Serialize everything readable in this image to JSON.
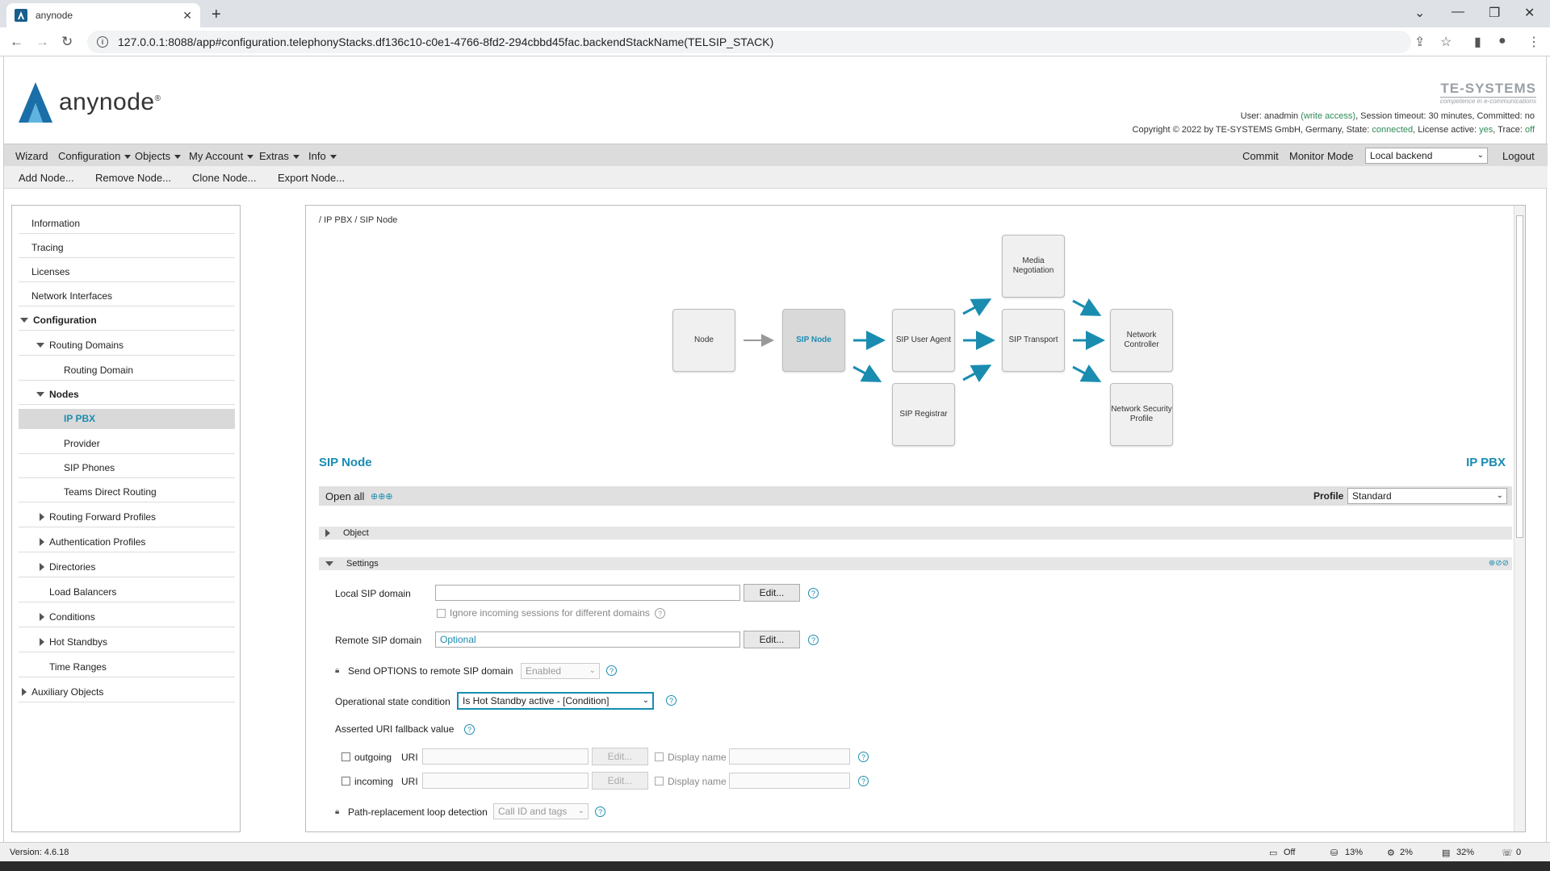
{
  "browser": {
    "tab_title": "anynode",
    "url": "127.0.0.1:8088/app#configuration.telephonyStacks.df136c10-c0e1-4766-8fd2-294cbbd45fac.backendStackName(TELSIP_STACK)"
  },
  "header": {
    "logo_text": "anynode",
    "logo_reg": "®",
    "brand_name": "TE-SYSTEMS",
    "brand_tagline": "competence in e-communications",
    "status_line1_prefix": "User: anadmin ",
    "status_write": "(write access)",
    "status_line1_suffix": ", Session timeout: 30 minutes, Committed: no",
    "status_line2_prefix": "Copyright © 2022 by TE-SYSTEMS GmbH, Germany, State: ",
    "status_state": "connected",
    "status_license_label": ", License active: ",
    "status_license": "yes",
    "status_trace_label": ", Trace: ",
    "status_trace": "off"
  },
  "menu": {
    "wizard": "Wizard",
    "configuration": "Configuration",
    "objects": "Objects",
    "my_account": "My Account",
    "extras": "Extras",
    "info": "Info",
    "commit": "Commit",
    "monitor_mode": "Monitor Mode",
    "backend_selected": "Local backend",
    "logout": "Logout"
  },
  "toolbar": {
    "add_node": "Add Node...",
    "remove_node": "Remove Node...",
    "clone_node": "Clone Node...",
    "export_node": "Export Node..."
  },
  "sidebar": {
    "items": [
      {
        "label": "Information"
      },
      {
        "label": "Tracing"
      },
      {
        "label": "Licenses"
      },
      {
        "label": "Network Interfaces"
      },
      {
        "label": "Configuration"
      },
      {
        "label": "Routing Domains"
      },
      {
        "label": "Routing Domain"
      },
      {
        "label": "Nodes"
      },
      {
        "label": "IP PBX"
      },
      {
        "label": "Provider"
      },
      {
        "label": "SIP Phones"
      },
      {
        "label": "Teams Direct Routing"
      },
      {
        "label": "Routing Forward Profiles"
      },
      {
        "label": "Authentication Profiles"
      },
      {
        "label": "Directories"
      },
      {
        "label": "Load Balancers"
      },
      {
        "label": "Conditions"
      },
      {
        "label": "Hot Standbys"
      },
      {
        "label": "Time Ranges"
      },
      {
        "label": "Auxiliary Objects"
      }
    ]
  },
  "main": {
    "breadcrumb": "/ IP PBX / SIP Node",
    "diagram": {
      "node": "Node",
      "sip_node": "SIP Node",
      "sip_user_agent": "SIP User Agent",
      "sip_registrar": "SIP Registrar",
      "media_negotiation": "Media Negotiation",
      "sip_transport": "SIP Transport",
      "network_controller": "Network Controller",
      "network_security_profile": "Network Security Profile"
    },
    "title": "SIP Node",
    "context_title": "IP PBX",
    "open_all": "Open all",
    "profile_label": "Profile",
    "profile_value": "Standard",
    "section_object": "Object",
    "section_settings": "Settings",
    "local_sip_domain_label": "Local SIP domain",
    "local_sip_domain_value": "",
    "edit_label": "Edit...",
    "ignore_incoming_label": "Ignore incoming sessions for different domains",
    "remote_sip_domain_label": "Remote SIP domain",
    "remote_sip_domain_placeholder": "Optional",
    "send_options_label": "Send OPTIONS to remote SIP domain",
    "send_options_value": "Enabled",
    "op_state_label": "Operational state condition",
    "op_state_value": "Is Hot Standby active - [Condition]",
    "asserted_uri_label": "Asserted URI fallback value",
    "outgoing_label": "outgoing",
    "incoming_label": "incoming",
    "uri_label": "URI",
    "display_name_label": "Display name",
    "path_replacement_label": "Path-replacement loop detection",
    "path_replacement_value": "Call ID and tags",
    "help_glyph": "?"
  },
  "footer": {
    "version": "Version: 4.6.18",
    "trace": "Off",
    "disk": "13%",
    "cpu": "2%",
    "memory": "32%",
    "calls": "0"
  }
}
